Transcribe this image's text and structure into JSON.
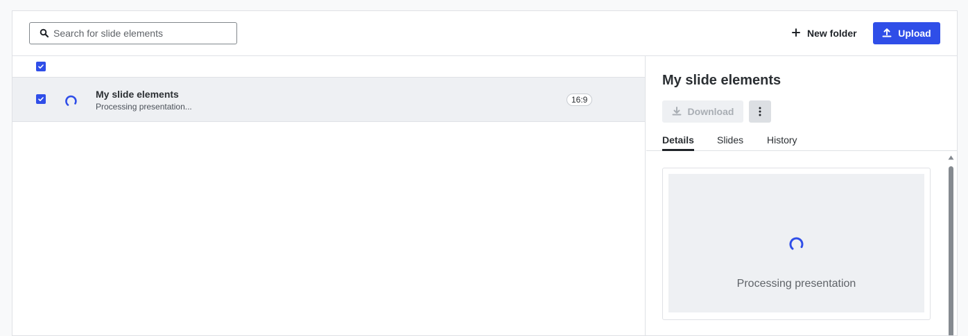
{
  "search": {
    "placeholder": "Search for slide elements"
  },
  "toolbar": {
    "new_folder_label": "New folder",
    "upload_label": "Upload"
  },
  "list": {
    "rows": [
      {
        "title": "My slide elements",
        "subtitle": "Processing presentation...",
        "aspect_ratio": "16:9",
        "checked": true
      }
    ],
    "select_all_checked": true
  },
  "detail": {
    "title": "My slide elements",
    "download_label": "Download",
    "tabs": [
      {
        "label": "Details",
        "active": true
      },
      {
        "label": "Slides",
        "active": false
      },
      {
        "label": "History",
        "active": false
      }
    ],
    "preview_text": "Processing presentation"
  },
  "colors": {
    "accent": "#2f4ee8",
    "row_selected_bg": "#eef0f3",
    "disabled_text": "#a9aeb4"
  },
  "icons": [
    "search-icon",
    "plus-icon",
    "upload-icon",
    "check-icon",
    "spinner-icon",
    "download-icon",
    "more-vertical-icon"
  ]
}
